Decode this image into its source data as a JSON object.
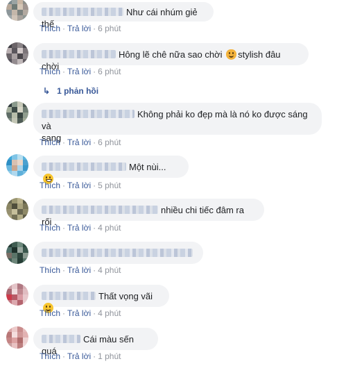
{
  "actions": {
    "like": "Thích",
    "reply": "Trả lời",
    "separator": "·"
  },
  "comments": [
    {
      "text": "Như cái nhúm giẻ thế",
      "time": "6 phút"
    },
    {
      "text": "Hông lẽ chê nữa sao chời",
      "emoji": "crying-cat-icon",
      "text_after": "stylish đâu chời",
      "time": "6 phút",
      "replies": "1 phản hồi"
    },
    {
      "text": "Không phải ko đẹp mà là nó ko được sáng và",
      "text_line2": "sang",
      "time": "6 phút"
    },
    {
      "text": "Một nùi...",
      "emoji": "grinning-face-icon",
      "time": "5 phút"
    },
    {
      "text": "nhiều chi tiếc đâm ra rối .",
      "time": "4 phút"
    },
    {
      "text": "",
      "time": "4 phút"
    },
    {
      "text": "Thất vọng vãi",
      "emoji": "smiling-face-icon",
      "time": "4 phút"
    },
    {
      "text": "Cái màu sến quá",
      "time": "1 phút"
    }
  ]
}
